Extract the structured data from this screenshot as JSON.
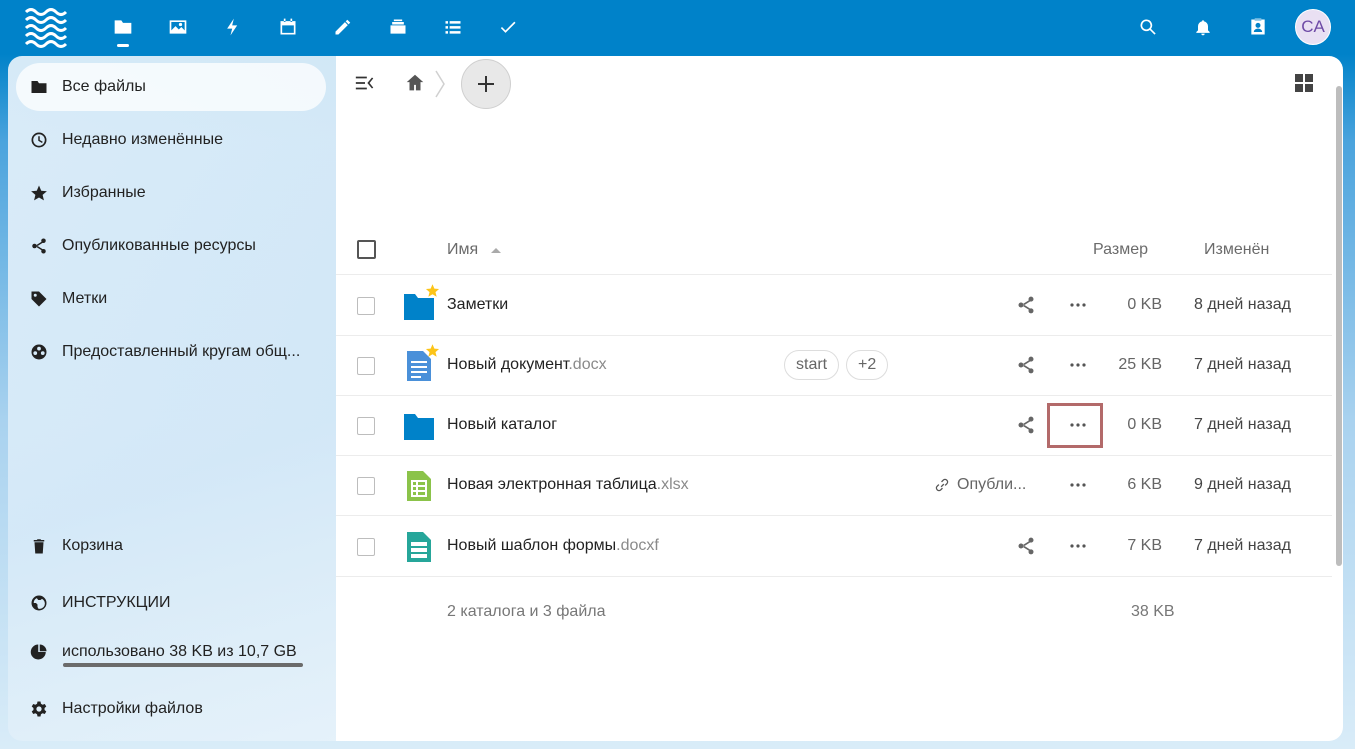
{
  "colors": {
    "primary": "#0082c9",
    "folder": "#0082c9",
    "star": "#fcc419",
    "sheet": "#8bc34a",
    "form": "#26a69a",
    "doc": "#4a90d9"
  },
  "header": {
    "logo": "nextcloud-logo",
    "apps": [
      "files-icon",
      "photos-icon",
      "activity-icon",
      "calendar-icon",
      "notes-icon",
      "deck-icon",
      "tasks-list-icon",
      "checkmark-icon"
    ],
    "right_icons": [
      "search-icon",
      "notifications-icon",
      "contacts-icon"
    ],
    "avatar_initials": "CA"
  },
  "sidebar": {
    "items": [
      {
        "label": "Все файлы",
        "icon": "folder-icon"
      },
      {
        "label": "Недавно изменённые",
        "icon": "clock-icon"
      },
      {
        "label": "Избранные",
        "icon": "star-icon"
      },
      {
        "label": "Опубликованные ресурсы",
        "icon": "share-icon"
      },
      {
        "label": "Метки",
        "icon": "tag-icon"
      },
      {
        "label": "Предоставленный кругам общ...",
        "icon": "circles-icon"
      }
    ],
    "footer": [
      {
        "label": "Корзина",
        "icon": "trash-icon"
      },
      {
        "label": "ИНСТРУКЦИИ",
        "icon": "globe-icon"
      },
      {
        "label": "использовано 38 KB из 10,7 GB",
        "icon": "pie-icon"
      },
      {
        "label": "Настройки файлов",
        "icon": "gear-icon"
      }
    ]
  },
  "table": {
    "col_name": "Имя",
    "col_size": "Размер",
    "col_modified": "Изменён",
    "rows": [
      {
        "name": "Заметки",
        "ext": "",
        "size": "0 KB",
        "modified": "8 дней назад",
        "type": "folder",
        "starred": true
      },
      {
        "name": "Новый документ",
        "ext": ".docx",
        "size": "25 KB",
        "modified": "7 дней назад",
        "type": "document",
        "starred": true,
        "tags": [
          "start",
          "+2"
        ]
      },
      {
        "name": "Новый каталог",
        "ext": "",
        "size": "0 KB",
        "modified": "7 дней назад",
        "type": "folder",
        "starred": false
      },
      {
        "name": "Новая электронная таблица",
        "ext": ".xlsx",
        "size": "6 KB",
        "modified": "9 дней назад",
        "type": "spreadsheet",
        "starred": false,
        "published": "Опубли..."
      },
      {
        "name": "Новый шаблон формы",
        "ext": ".docxf",
        "size": "7 KB",
        "modified": "7 дней назад",
        "type": "form",
        "starred": false
      }
    ],
    "summary": "2 каталога и 3 файла",
    "summary_size": "38 KB"
  }
}
